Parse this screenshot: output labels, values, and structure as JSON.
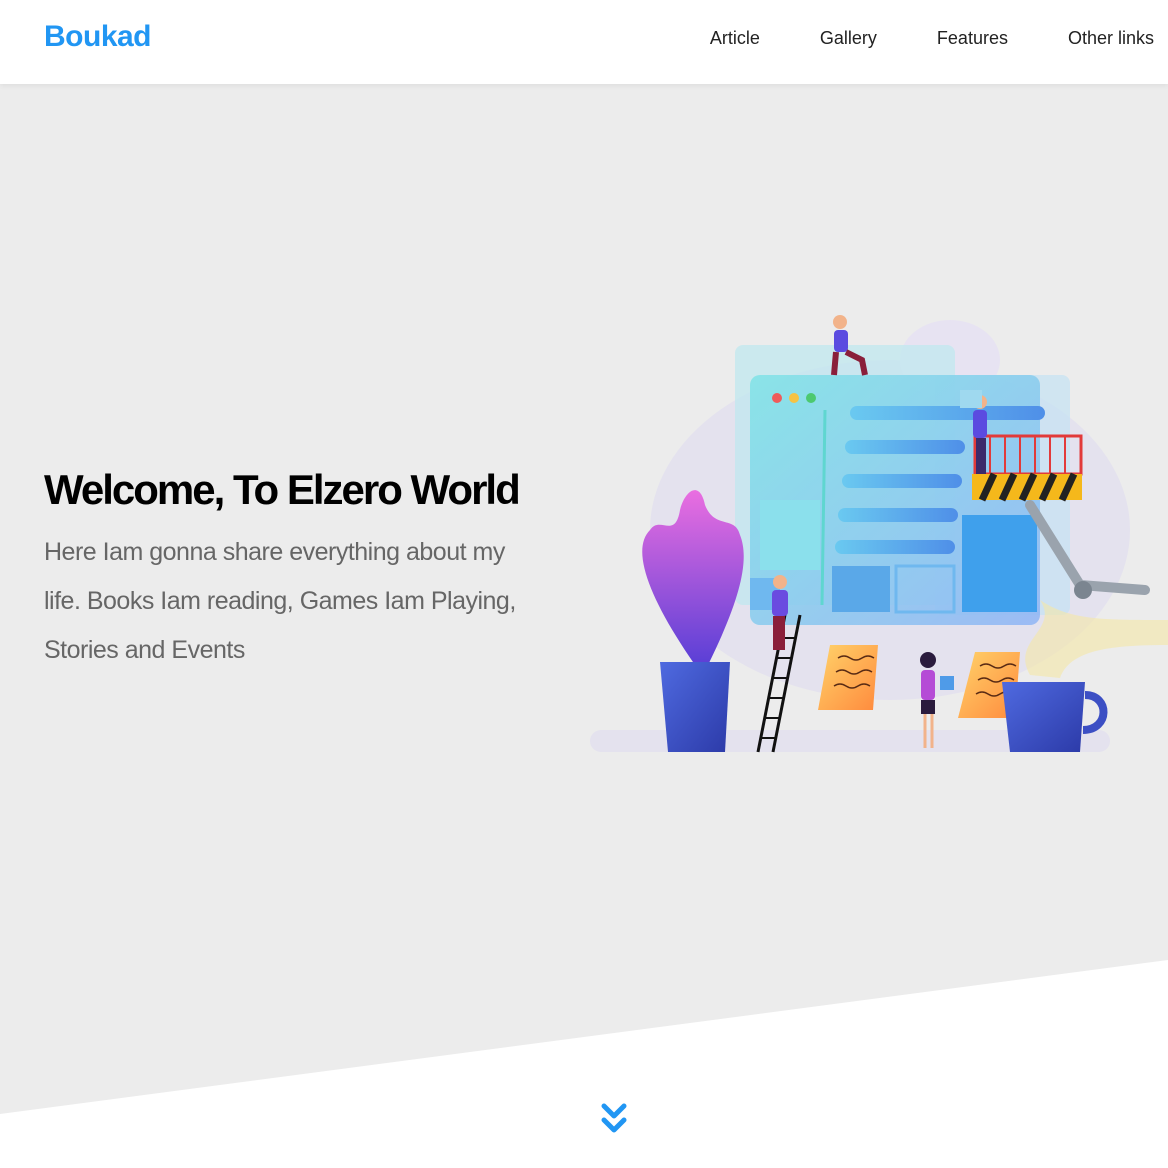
{
  "header": {
    "logo": "Boukad",
    "nav": [
      {
        "label": "Article"
      },
      {
        "label": "Gallery"
      },
      {
        "label": "Features"
      },
      {
        "label": "Other links"
      }
    ]
  },
  "landing": {
    "title": "Welcome, To Elzero World",
    "description": "Here Iam gonna share everything about my life. Books Iam reading, Games Iam Playing, Stories and Events"
  },
  "icons": {
    "scroll": "angles-down-icon"
  },
  "colors": {
    "brand": "#2196f3",
    "landing_bg": "#ececec",
    "text_dark": "#000000",
    "text_muted": "#666666"
  }
}
